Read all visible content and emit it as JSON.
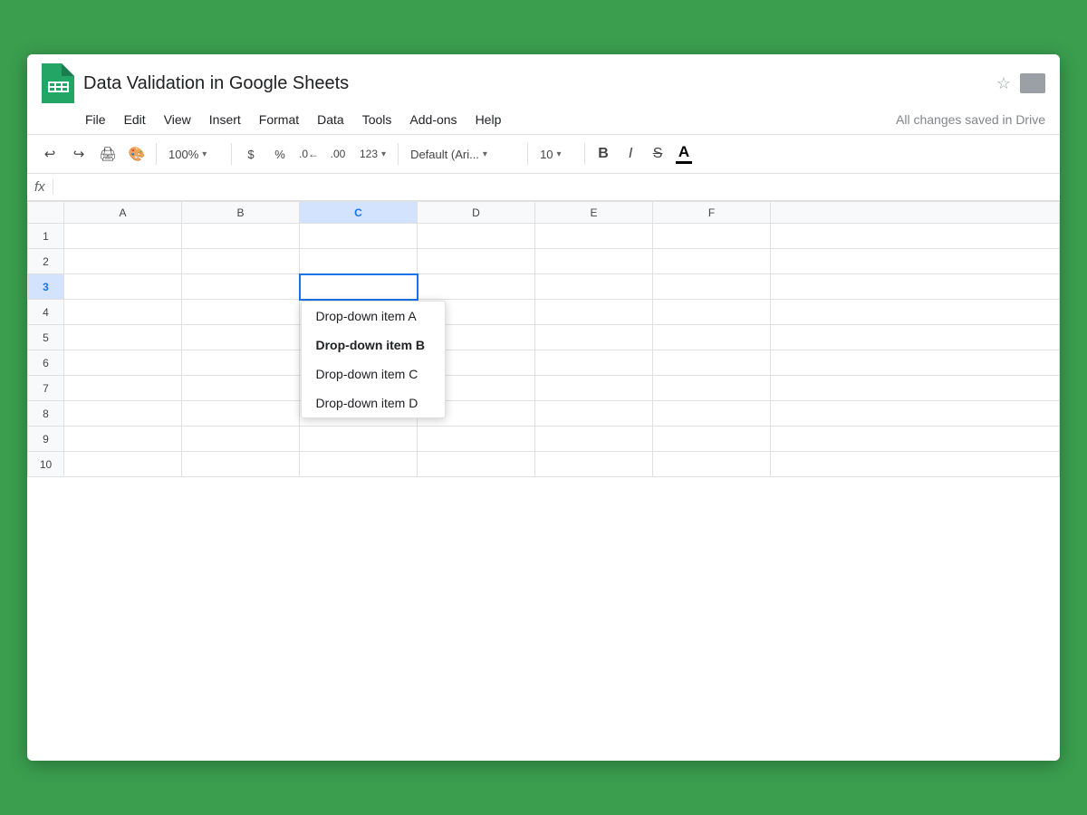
{
  "window": {
    "title": "Data Validation in Google Sheets",
    "saved_status": "All changes saved in Drive"
  },
  "menu": {
    "items": [
      "File",
      "Edit",
      "View",
      "Insert",
      "Format",
      "Data",
      "Tools",
      "Add-ons",
      "Help"
    ]
  },
  "toolbar": {
    "zoom": "100%",
    "font_name": "Default (Ari...",
    "font_size": "10",
    "bold_label": "B",
    "italic_label": "I",
    "strikethrough_label": "S",
    "underline_label": "A"
  },
  "formula_bar": {
    "fx_label": "fx"
  },
  "grid": {
    "columns": [
      "A",
      "B",
      "C",
      "D",
      "E",
      "F"
    ],
    "rows": [
      1,
      2,
      3,
      4,
      5,
      6,
      7,
      8,
      9,
      10
    ],
    "active_cell": "C3"
  },
  "dropdown": {
    "items": [
      {
        "label": "Drop-down item A",
        "selected": false
      },
      {
        "label": "Drop-down item B",
        "selected": true
      },
      {
        "label": "Drop-down item C",
        "selected": false
      },
      {
        "label": "Drop-down item D",
        "selected": false
      }
    ]
  }
}
